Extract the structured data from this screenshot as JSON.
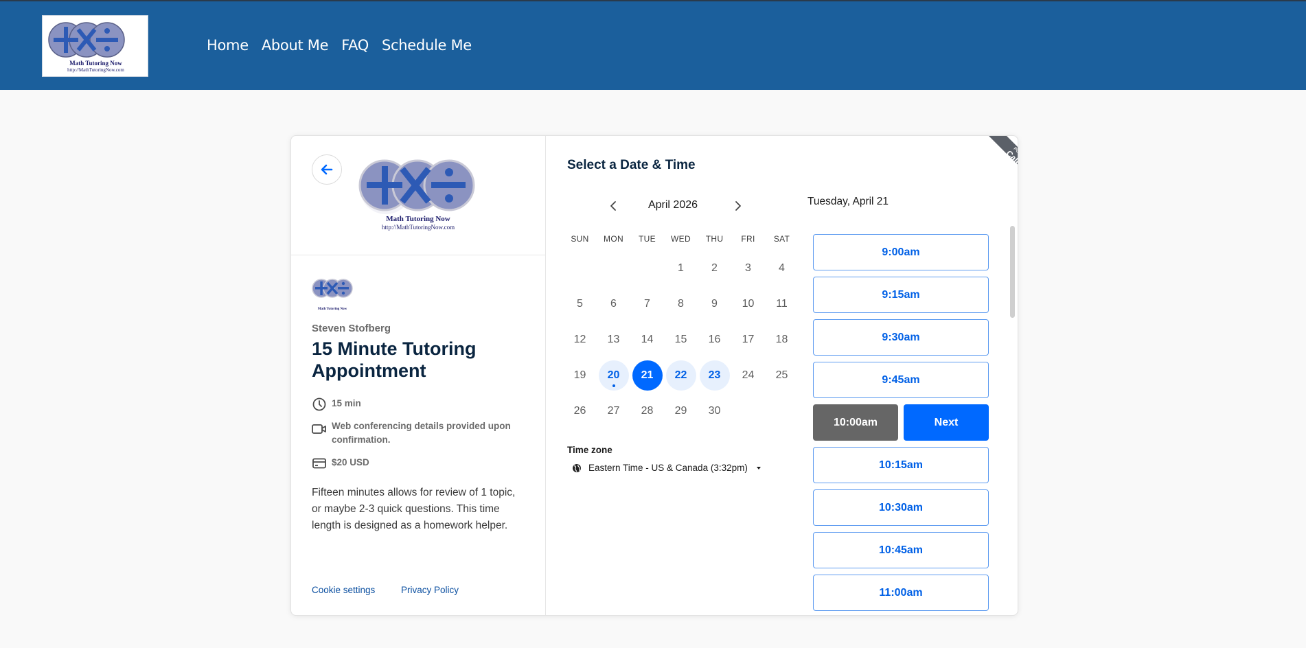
{
  "header": {
    "logo_title": "Math Tutoring Now",
    "logo_url": "http://MathTutoringNow.com",
    "nav": [
      "Home",
      "About Me",
      "FAQ",
      "Schedule Me"
    ]
  },
  "event": {
    "organizer": "Steven Stofberg",
    "title": "15 Minute Tutoring Appointment",
    "duration": "15 min",
    "conferencing": "Web conferencing details provided upon confirmation.",
    "price": "$20 USD",
    "description": "Fifteen minutes allows for review of 1 topic, or maybe 2-3 quick questions. This time length is designed as a homework helper.",
    "cookie_link": "Cookie settings",
    "privacy_link": "Privacy Policy"
  },
  "calendar": {
    "section_title": "Select a Date & Time",
    "month": "April 2026",
    "weekdays": [
      "SUN",
      "MON",
      "TUE",
      "WED",
      "THU",
      "FRI",
      "SAT"
    ],
    "first_weekday_index": 3,
    "days_in_month": 30,
    "available_days": [
      20,
      21,
      22,
      23
    ],
    "selected_day": 21,
    "today": 20,
    "timezone_label": "Time zone",
    "timezone": "Eastern Time - US & Canada (3:32pm)"
  },
  "times": {
    "selected_date": "Tuesday, April 21",
    "slots": [
      "9:00am",
      "9:15am",
      "9:30am",
      "9:45am",
      "10:00am",
      "10:15am",
      "10:30am",
      "10:45am",
      "11:00am"
    ],
    "selected_slot": "10:00am",
    "next_label": "Next"
  },
  "badge": {
    "line1": "POWERED BY",
    "line2": "Calendly"
  },
  "colors": {
    "header_bg": "#1b5f9c",
    "accent": "#0069ff",
    "available_bg": "#e7f0fd",
    "selected_time_bg": "#666666"
  },
  "icons": [
    "back-arrow-icon",
    "clock-icon",
    "video-icon",
    "credit-card-icon",
    "chevron-left-icon",
    "chevron-right-icon",
    "globe-icon"
  ]
}
